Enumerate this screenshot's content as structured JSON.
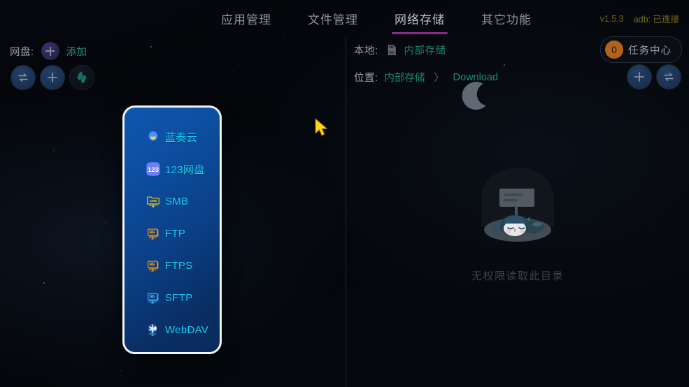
{
  "header": {
    "tabs": [
      {
        "label": "应用管理",
        "active": false
      },
      {
        "label": "文件管理",
        "active": false
      },
      {
        "label": "网络存储",
        "active": true
      },
      {
        "label": "其它功能",
        "active": false
      }
    ],
    "version": "v1.5.3",
    "adb_status": "adb: 已连接",
    "accent_color": "#8d2a8d"
  },
  "left_pane": {
    "netdisk_label": "网盘:",
    "add_label": "添加",
    "toolbar": [
      {
        "name": "transfer-button",
        "icon": "transfer-icon"
      },
      {
        "name": "add-button",
        "icon": "plus-icon"
      },
      {
        "name": "refresh-button",
        "icon": "refresh-icon"
      }
    ],
    "dropdown": {
      "items": [
        {
          "label": "蓝奏云",
          "icon": "lanzou-cloud-icon"
        },
        {
          "label": "123网盘",
          "icon": "pan123-icon"
        },
        {
          "label": "SMB",
          "icon": "smb-icon"
        },
        {
          "label": "FTP",
          "icon": "ftp-icon"
        },
        {
          "label": "FTPS",
          "icon": "ftps-icon"
        },
        {
          "label": "SFTP",
          "icon": "sftp-icon"
        },
        {
          "label": "WebDAV",
          "icon": "webdav-icon"
        }
      ]
    }
  },
  "right_pane": {
    "local_label": "本地:",
    "local_storage": "内部存储",
    "location_label": "位置:",
    "breadcrumb": [
      "内部存储",
      "Download"
    ],
    "breadcrumb_separator": "〉",
    "task_center": {
      "count": "0",
      "label": "任务中心",
      "badge_color": "#b3621a"
    },
    "actions": [
      {
        "name": "add-button",
        "icon": "plus-icon"
      },
      {
        "name": "transfer-button",
        "icon": "transfer-icon"
      }
    ],
    "empty_state": {
      "message": "无权限读取此目录"
    }
  }
}
